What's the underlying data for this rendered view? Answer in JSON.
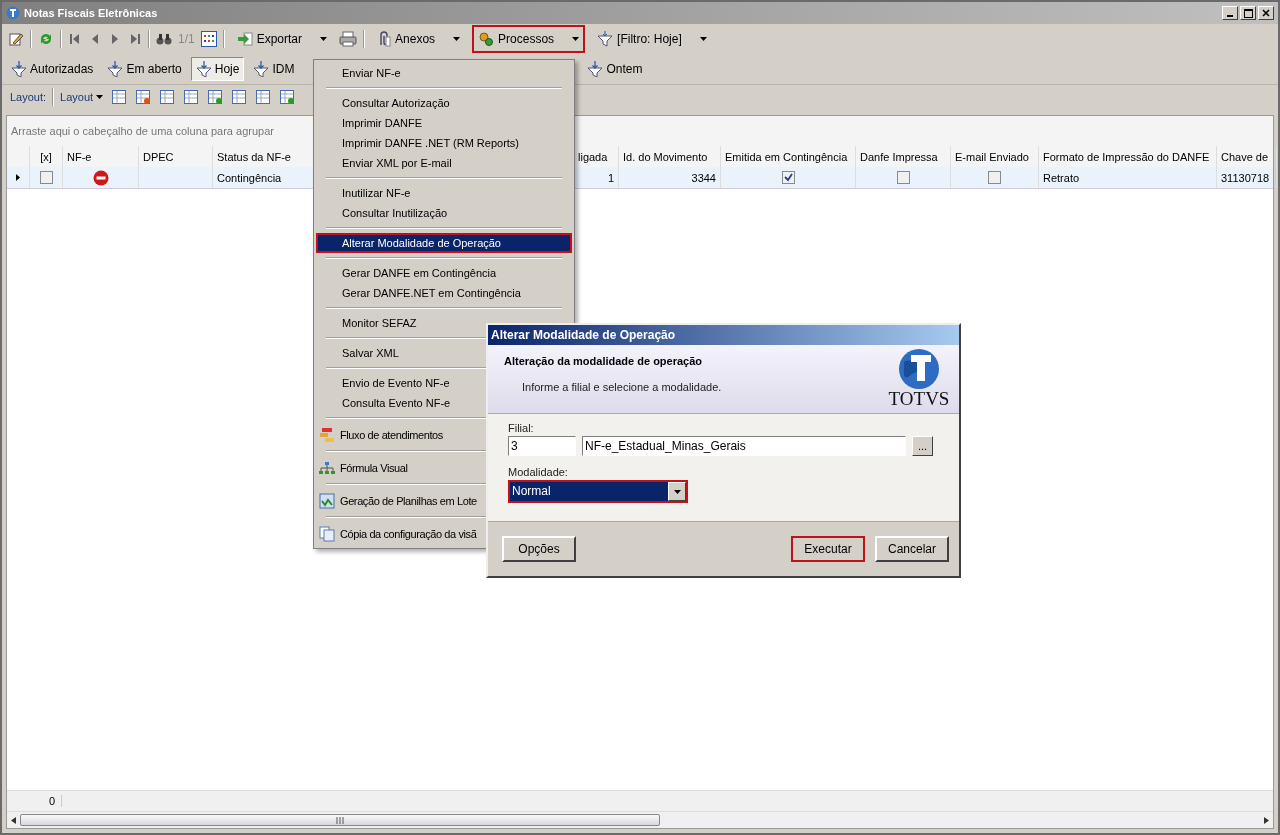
{
  "window": {
    "title": "Notas Fiscais Eletrônicas"
  },
  "toolbar": {
    "pager": "1/1",
    "buttons": [
      {
        "label": "Exportar",
        "highlighted": false
      },
      {
        "label": "Anexos",
        "highlighted": false
      },
      {
        "label": "Processos",
        "highlighted": true
      },
      {
        "label": "[Filtro: Hoje]",
        "highlighted": false
      }
    ]
  },
  "filter_tabs": [
    {
      "label": "Autorizadas",
      "selected": false
    },
    {
      "label": "Em aberto",
      "selected": false
    },
    {
      "label": "Hoje",
      "selected": true
    },
    {
      "label": "IDM",
      "selected": false
    },
    {
      "label": "Ontem",
      "selected": false
    }
  ],
  "layout_bar": {
    "label": "Layout:",
    "menu": "Layout"
  },
  "group_hint": "Arraste aqui o cabeçalho de uma coluna para agrupar",
  "table": {
    "columns": [
      "[x]",
      "NF-e",
      "DPEC",
      "Status da NF-e",
      "ligada",
      "Id. do Movimento",
      "Emitida em Contingência",
      "Danfe Impressa",
      "E-mail Enviado",
      "Formato de Impressão do DANFE",
      "Chave de"
    ],
    "rows": [
      {
        "cells": [
          {
            "kind": "check",
            "checked": false
          },
          {
            "kind": "stop"
          },
          {
            "kind": "text",
            "text": ""
          },
          {
            "kind": "text",
            "text": "Contingência"
          },
          {
            "kind": "number",
            "text": "1"
          },
          {
            "kind": "number",
            "text": "3344"
          },
          {
            "kind": "check",
            "checked": true
          },
          {
            "kind": "check",
            "checked": false
          },
          {
            "kind": "check",
            "checked": false
          },
          {
            "kind": "text",
            "text": "Retrato"
          },
          {
            "kind": "text",
            "text": "31130718"
          }
        ]
      }
    ]
  },
  "footer": {
    "count": "0"
  },
  "menu": {
    "items": [
      {
        "kind": "item",
        "label": "Enviar NF-e",
        "selected": false
      },
      {
        "kind": "separator"
      },
      {
        "kind": "item",
        "label": "Consultar Autorização",
        "selected": false
      },
      {
        "kind": "item",
        "label": "Imprimir DANFE",
        "selected": false
      },
      {
        "kind": "item",
        "label": "Imprimir DANFE .NET (RM Reports)",
        "selected": false
      },
      {
        "kind": "item",
        "label": "Enviar XML por E-mail",
        "selected": false
      },
      {
        "kind": "separator"
      },
      {
        "kind": "item",
        "label": "Inutilizar NF-e",
        "selected": false
      },
      {
        "kind": "item",
        "label": "Consultar Inutilização",
        "selected": false
      },
      {
        "kind": "separator"
      },
      {
        "kind": "item",
        "label": "Alterar Modalidade de Operação",
        "selected": true
      },
      {
        "kind": "separator"
      },
      {
        "kind": "item",
        "label": "Gerar DANFE em Contingência",
        "selected": false
      },
      {
        "kind": "item",
        "label": "Gerar DANFE.NET em Contingência",
        "selected": false
      },
      {
        "kind": "separator"
      },
      {
        "kind": "item",
        "label": "Monitor SEFAZ",
        "selected": false
      },
      {
        "kind": "separator"
      },
      {
        "kind": "item",
        "label": "Salvar XML",
        "selected": false
      },
      {
        "kind": "separator"
      },
      {
        "kind": "item",
        "label": "Envio de Evento NF-e",
        "selected": false
      },
      {
        "kind": "item",
        "label": "Consulta Evento NF-e",
        "selected": false
      },
      {
        "kind": "separator"
      },
      {
        "kind": "icon_item",
        "label": "Fluxo de atendimentos",
        "selected": false
      },
      {
        "kind": "separator"
      },
      {
        "kind": "icon_item",
        "label": "Fórmula Visual",
        "selected": false
      },
      {
        "kind": "separator"
      },
      {
        "kind": "icon_item",
        "label": "Geração de Planilhas em Lote",
        "selected": false
      },
      {
        "kind": "separator"
      },
      {
        "kind": "icon_item",
        "label": "Cópia da configuração da visã",
        "selected": false
      }
    ]
  },
  "dialog": {
    "title": "Alterar Modalidade de Operação",
    "heading": "Alteração da modalidade de operação",
    "subtitle": "Informe a filial e selecione a modalidade.",
    "logo": "TOTVS",
    "filial_label": "Filial:",
    "filial_code": "3",
    "filial_name": "NF-e_Estadual_Minas_Gerais",
    "browse": "...",
    "modalidade_label": "Modalidade:",
    "modalidade": {
      "value": "Normal",
      "highlighted": true
    },
    "buttons": [
      {
        "label": "Opções",
        "highlighted": false
      },
      {
        "label": "Executar",
        "highlighted": true
      },
      {
        "label": "Cancelar",
        "highlighted": false
      }
    ]
  }
}
